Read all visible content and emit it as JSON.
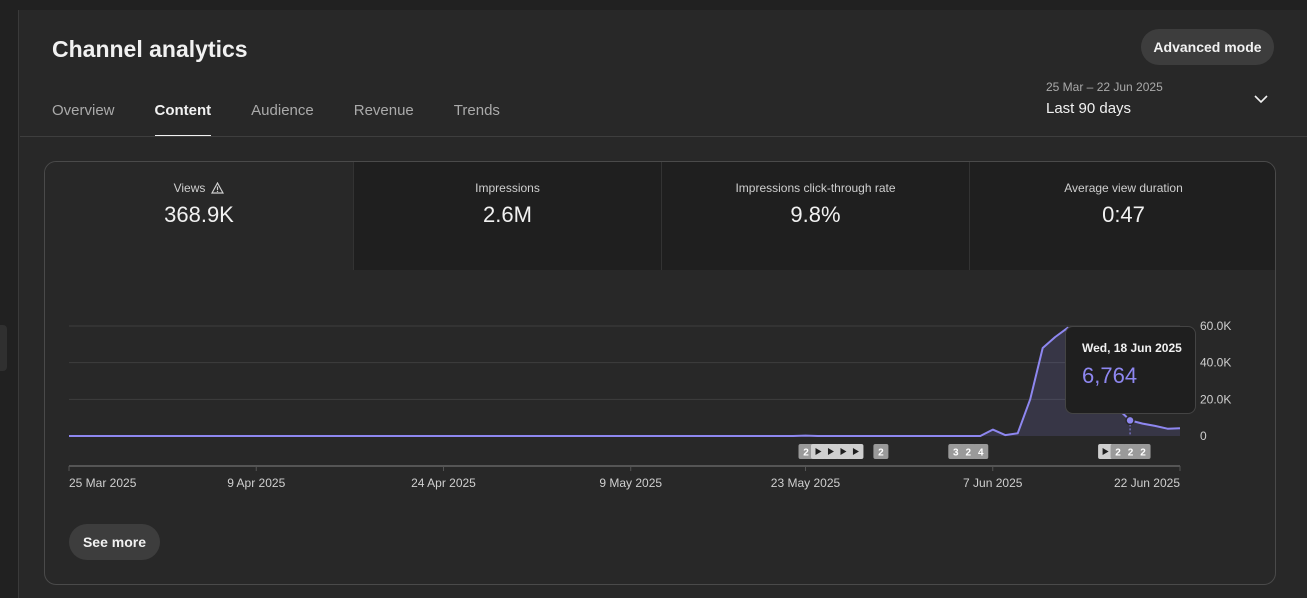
{
  "header": {
    "title": "Channel analytics",
    "advanced_mode_label": "Advanced mode"
  },
  "tabs": [
    {
      "label": "Overview",
      "active": false
    },
    {
      "label": "Content",
      "active": true
    },
    {
      "label": "Audience",
      "active": false
    },
    {
      "label": "Revenue",
      "active": false
    },
    {
      "label": "Trends",
      "active": false
    }
  ],
  "date_picker": {
    "range": "25 Mar – 22 Jun 2025",
    "label": "Last 90 days",
    "icon": "chevron-down-icon"
  },
  "metrics": [
    {
      "label": "Views",
      "value": "368.9K",
      "warning_icon": true,
      "active": true
    },
    {
      "label": "Impressions",
      "value": "2.6M",
      "warning_icon": false,
      "active": false
    },
    {
      "label": "Impressions click-through rate",
      "value": "9.8%",
      "warning_icon": false,
      "active": false
    },
    {
      "label": "Average view duration",
      "value": "0:47",
      "warning_icon": false,
      "active": false
    }
  ],
  "chart_data": {
    "type": "area",
    "x": [
      "25 Mar 2025",
      "26 Mar 2025",
      "27 Mar 2025",
      "28 Mar 2025",
      "29 Mar 2025",
      "30 Mar 2025",
      "31 Mar 2025",
      "1 Apr 2025",
      "2 Apr 2025",
      "3 Apr 2025",
      "4 Apr 2025",
      "5 Apr 2025",
      "6 Apr 2025",
      "7 Apr 2025",
      "8 Apr 2025",
      "9 Apr 2025",
      "10 Apr 2025",
      "11 Apr 2025",
      "12 Apr 2025",
      "13 Apr 2025",
      "14 Apr 2025",
      "15 Apr 2025",
      "16 Apr 2025",
      "17 Apr 2025",
      "18 Apr 2025",
      "19 Apr 2025",
      "20 Apr 2025",
      "21 Apr 2025",
      "22 Apr 2025",
      "23 Apr 2025",
      "24 Apr 2025",
      "25 Apr 2025",
      "26 Apr 2025",
      "27 Apr 2025",
      "28 Apr 2025",
      "29 Apr 2025",
      "30 Apr 2025",
      "1 May 2025",
      "2 May 2025",
      "3 May 2025",
      "4 May 2025",
      "5 May 2025",
      "6 May 2025",
      "7 May 2025",
      "8 May 2025",
      "9 May 2025",
      "10 May 2025",
      "11 May 2025",
      "12 May 2025",
      "13 May 2025",
      "14 May 2025",
      "15 May 2025",
      "16 May 2025",
      "17 May 2025",
      "18 May 2025",
      "19 May 2025",
      "20 May 2025",
      "21 May 2025",
      "22 May 2025",
      "23 May 2025",
      "24 May 2025",
      "25 May 2025",
      "26 May 2025",
      "27 May 2025",
      "28 May 2025",
      "29 May 2025",
      "30 May 2025",
      "31 May 2025",
      "1 Jun 2025",
      "2 Jun 2025",
      "3 Jun 2025",
      "4 Jun 2025",
      "5 Jun 2025",
      "6 Jun 2025",
      "7 Jun 2025",
      "8 Jun 2025",
      "9 Jun 2025",
      "10 Jun 2025",
      "11 Jun 2025",
      "12 Jun 2025",
      "13 Jun 2025",
      "14 Jun 2025",
      "15 Jun 2025",
      "16 Jun 2025",
      "17 Jun 2025",
      "18 Jun 2025",
      "19 Jun 2025",
      "20 Jun 2025",
      "21 Jun 2025",
      "22 Jun 2025"
    ],
    "series": [
      {
        "values": [
          0,
          0,
          0,
          0,
          0,
          0,
          0,
          0,
          0,
          0,
          0,
          0,
          0,
          0,
          0,
          0,
          0,
          0,
          0,
          0,
          0,
          0,
          0,
          0,
          0,
          0,
          0,
          0,
          0,
          0,
          0,
          0,
          0,
          0,
          0,
          0,
          0,
          0,
          0,
          0,
          0,
          0,
          0,
          0,
          0,
          0,
          0,
          0,
          0,
          0,
          0,
          0,
          0,
          0,
          0,
          0,
          0,
          0,
          0,
          200,
          0,
          0,
          0,
          0,
          0,
          0,
          0,
          0,
          0,
          0,
          0,
          0,
          0,
          0,
          3500,
          500,
          1500,
          20000,
          48000,
          54000,
          59000,
          50000,
          41000,
          27000,
          15000,
          8500,
          6764,
          5500,
          4000,
          4200
        ]
      }
    ],
    "xticks": [
      "25 Mar 2025",
      "9 Apr 2025",
      "24 Apr 2025",
      "9 May 2025",
      "23 May 2025",
      "7 Jun 2025",
      "22 Jun 2025"
    ],
    "yticks": [
      "0",
      "20.0K",
      "40.0K",
      "60.0K"
    ],
    "ylim": [
      0,
      60000
    ],
    "grid": true,
    "color": "#8e87f0",
    "markers": [
      {
        "date": "23 May 2025",
        "label": "2",
        "kind": "count"
      },
      {
        "date": "24 May 2025",
        "label": "",
        "kind": "video"
      },
      {
        "date": "25 May 2025",
        "label": "",
        "kind": "video"
      },
      {
        "date": "26 May 2025",
        "label": "",
        "kind": "video"
      },
      {
        "date": "27 May 2025",
        "label": "",
        "kind": "video"
      },
      {
        "date": "29 May 2025",
        "label": "2",
        "kind": "count"
      },
      {
        "date": "4 Jun 2025",
        "label": "3",
        "kind": "count"
      },
      {
        "date": "5 Jun 2025",
        "label": "2",
        "kind": "count"
      },
      {
        "date": "6 Jun 2025",
        "label": "4",
        "kind": "count"
      },
      {
        "date": "16 Jun 2025",
        "label": "",
        "kind": "video"
      },
      {
        "date": "17 Jun 2025",
        "label": "2",
        "kind": "count"
      },
      {
        "date": "18 Jun 2025",
        "label": "2",
        "kind": "count"
      },
      {
        "date": "19 Jun 2025",
        "label": "2",
        "kind": "count"
      }
    ],
    "tooltip": {
      "date": "Wed, 18 Jun 2025",
      "value": "6,764",
      "x": "18 Jun 2025"
    }
  },
  "see_more_label": "See more"
}
